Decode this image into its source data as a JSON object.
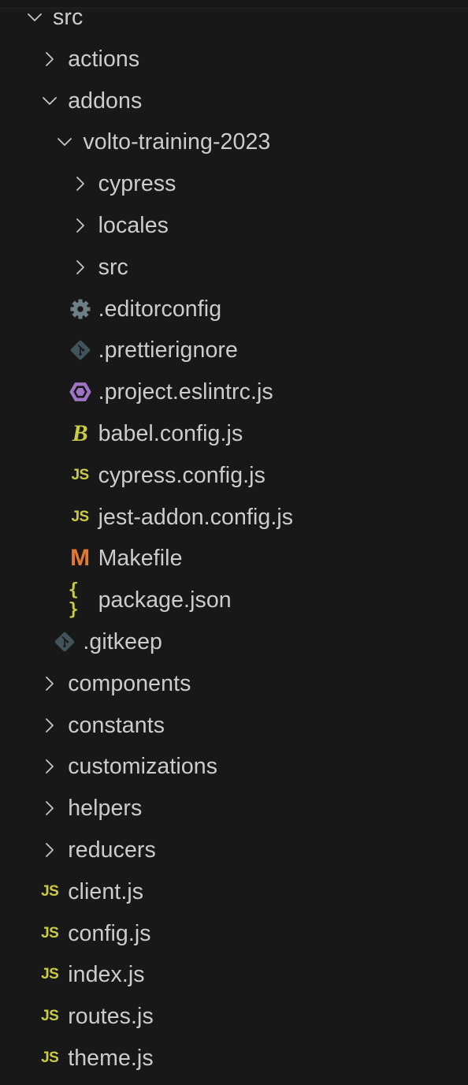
{
  "explorer": {
    "colors": {
      "background": "#181818",
      "text": "#cccccc",
      "chevron": "#c5c5c5",
      "js_icon": "#cbcb41",
      "json_icon": "#cbcb41",
      "babel_icon": "#cbcb41",
      "makefile_icon": "#e37933",
      "eslint_icon": "#a074c4",
      "gear_icon": "#6d8086",
      "git_icon": "#41535b"
    },
    "items": [
      {
        "label": "src",
        "type": "folder",
        "expanded": true,
        "depth": 0,
        "icon": "chevron-down-icon"
      },
      {
        "label": "actions",
        "type": "folder",
        "expanded": false,
        "depth": 1,
        "icon": "chevron-right-icon"
      },
      {
        "label": "addons",
        "type": "folder",
        "expanded": true,
        "depth": 1,
        "icon": "chevron-down-icon"
      },
      {
        "label": "volto-training-2023",
        "type": "folder",
        "expanded": true,
        "depth": 2,
        "icon": "chevron-down-icon"
      },
      {
        "label": "cypress",
        "type": "folder",
        "expanded": false,
        "depth": 3,
        "icon": "chevron-right-icon"
      },
      {
        "label": "locales",
        "type": "folder",
        "expanded": false,
        "depth": 3,
        "icon": "chevron-right-icon"
      },
      {
        "label": "src",
        "type": "folder",
        "expanded": false,
        "depth": 3,
        "icon": "chevron-right-icon"
      },
      {
        "label": ".editorconfig",
        "type": "file",
        "depth": 3,
        "icon": "gear-icon"
      },
      {
        "label": ".prettierignore",
        "type": "file",
        "depth": 3,
        "icon": "git-icon"
      },
      {
        "label": ".project.eslintrc.js",
        "type": "file",
        "depth": 3,
        "icon": "eslint-icon"
      },
      {
        "label": "babel.config.js",
        "type": "file",
        "depth": 3,
        "icon": "babel-icon",
        "glyph": "B"
      },
      {
        "label": "cypress.config.js",
        "type": "file",
        "depth": 3,
        "icon": "js-icon",
        "glyph": "JS"
      },
      {
        "label": "jest-addon.config.js",
        "type": "file",
        "depth": 3,
        "icon": "js-icon",
        "glyph": "JS"
      },
      {
        "label": "Makefile",
        "type": "file",
        "depth": 3,
        "icon": "makefile-icon",
        "glyph": "M"
      },
      {
        "label": "package.json",
        "type": "file",
        "depth": 3,
        "icon": "json-icon",
        "glyph": "{ }"
      },
      {
        "label": ".gitkeep",
        "type": "file",
        "depth": 2,
        "icon": "git-icon"
      },
      {
        "label": "components",
        "type": "folder",
        "expanded": false,
        "depth": 1,
        "icon": "chevron-right-icon"
      },
      {
        "label": "constants",
        "type": "folder",
        "expanded": false,
        "depth": 1,
        "icon": "chevron-right-icon"
      },
      {
        "label": "customizations",
        "type": "folder",
        "expanded": false,
        "depth": 1,
        "icon": "chevron-right-icon"
      },
      {
        "label": "helpers",
        "type": "folder",
        "expanded": false,
        "depth": 1,
        "icon": "chevron-right-icon"
      },
      {
        "label": "reducers",
        "type": "folder",
        "expanded": false,
        "depth": 1,
        "icon": "chevron-right-icon"
      },
      {
        "label": "client.js",
        "type": "file",
        "depth": 1,
        "icon": "js-icon",
        "glyph": "JS"
      },
      {
        "label": "config.js",
        "type": "file",
        "depth": 1,
        "icon": "js-icon",
        "glyph": "JS"
      },
      {
        "label": "index.js",
        "type": "file",
        "depth": 1,
        "icon": "js-icon",
        "glyph": "JS"
      },
      {
        "label": "routes.js",
        "type": "file",
        "depth": 1,
        "icon": "js-icon",
        "glyph": "JS"
      },
      {
        "label": "theme.js",
        "type": "file",
        "depth": 1,
        "icon": "js-icon",
        "glyph": "JS"
      }
    ]
  }
}
